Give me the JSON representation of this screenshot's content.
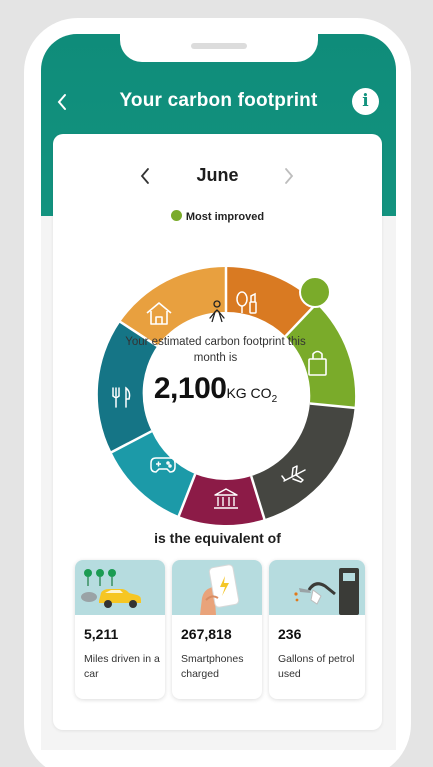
{
  "header": {
    "title": "Your carbon footprint",
    "info_label": "i"
  },
  "month_selector": {
    "month": "June"
  },
  "legend": {
    "label": "Most improved",
    "color": "#7aab2a"
  },
  "footprint": {
    "description": "Your estimated carbon footprint this month is",
    "value": "2,100",
    "unit": "KG CO",
    "unit_subscript": "2"
  },
  "categories": [
    {
      "name": "home-icon",
      "color": "#e8a03f"
    },
    {
      "name": "beauty-icon",
      "color": "#d97a22"
    },
    {
      "name": "shopping-bag-icon",
      "color": "#7aab2a"
    },
    {
      "name": "airplane-icon",
      "color": "#454641"
    },
    {
      "name": "bank-icon",
      "color": "#8c1b47"
    },
    {
      "name": "gamepad-icon",
      "color": "#1c9aa8"
    },
    {
      "name": "fork-knife-icon",
      "color": "#157586"
    }
  ],
  "equivalent": {
    "heading": "is the equivalent of",
    "items": [
      {
        "value": "5,211",
        "label": "Miles driven in a car",
        "icon": "car-icon"
      },
      {
        "value": "267,818",
        "label": "Smartphones charged",
        "icon": "smartphone-icon"
      },
      {
        "value": "236",
        "label": "Gallons of petrol used",
        "icon": "fuel-pump-icon"
      }
    ]
  }
}
